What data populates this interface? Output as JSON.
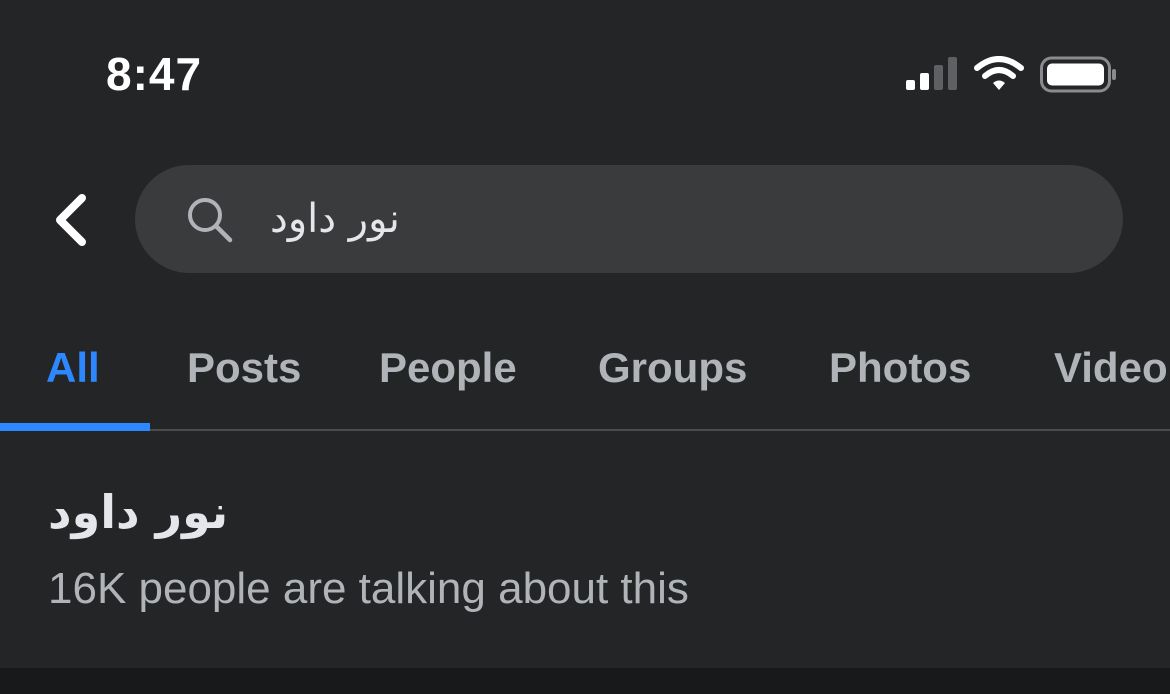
{
  "status_bar": {
    "time": "8:47",
    "icons": [
      "signal-icon",
      "wifi-icon",
      "battery-icon"
    ]
  },
  "header": {
    "back_icon": "chevron-left-icon",
    "search": {
      "icon": "search-icon",
      "value": "نور داود"
    }
  },
  "tabs": [
    {
      "label": "All",
      "active": true
    },
    {
      "label": "Posts",
      "active": false
    },
    {
      "label": "People",
      "active": false
    },
    {
      "label": "Groups",
      "active": false
    },
    {
      "label": "Photos",
      "active": false
    },
    {
      "label": "Video",
      "active": false
    }
  ],
  "result": {
    "title": "نور داود",
    "subtitle": "16K people are talking about this"
  },
  "colors": {
    "background": "#242526",
    "accent": "#2d88ff",
    "search_field": "#3a3b3c",
    "text_primary": "#e4e6eb",
    "text_secondary": "#b0b3b8"
  }
}
